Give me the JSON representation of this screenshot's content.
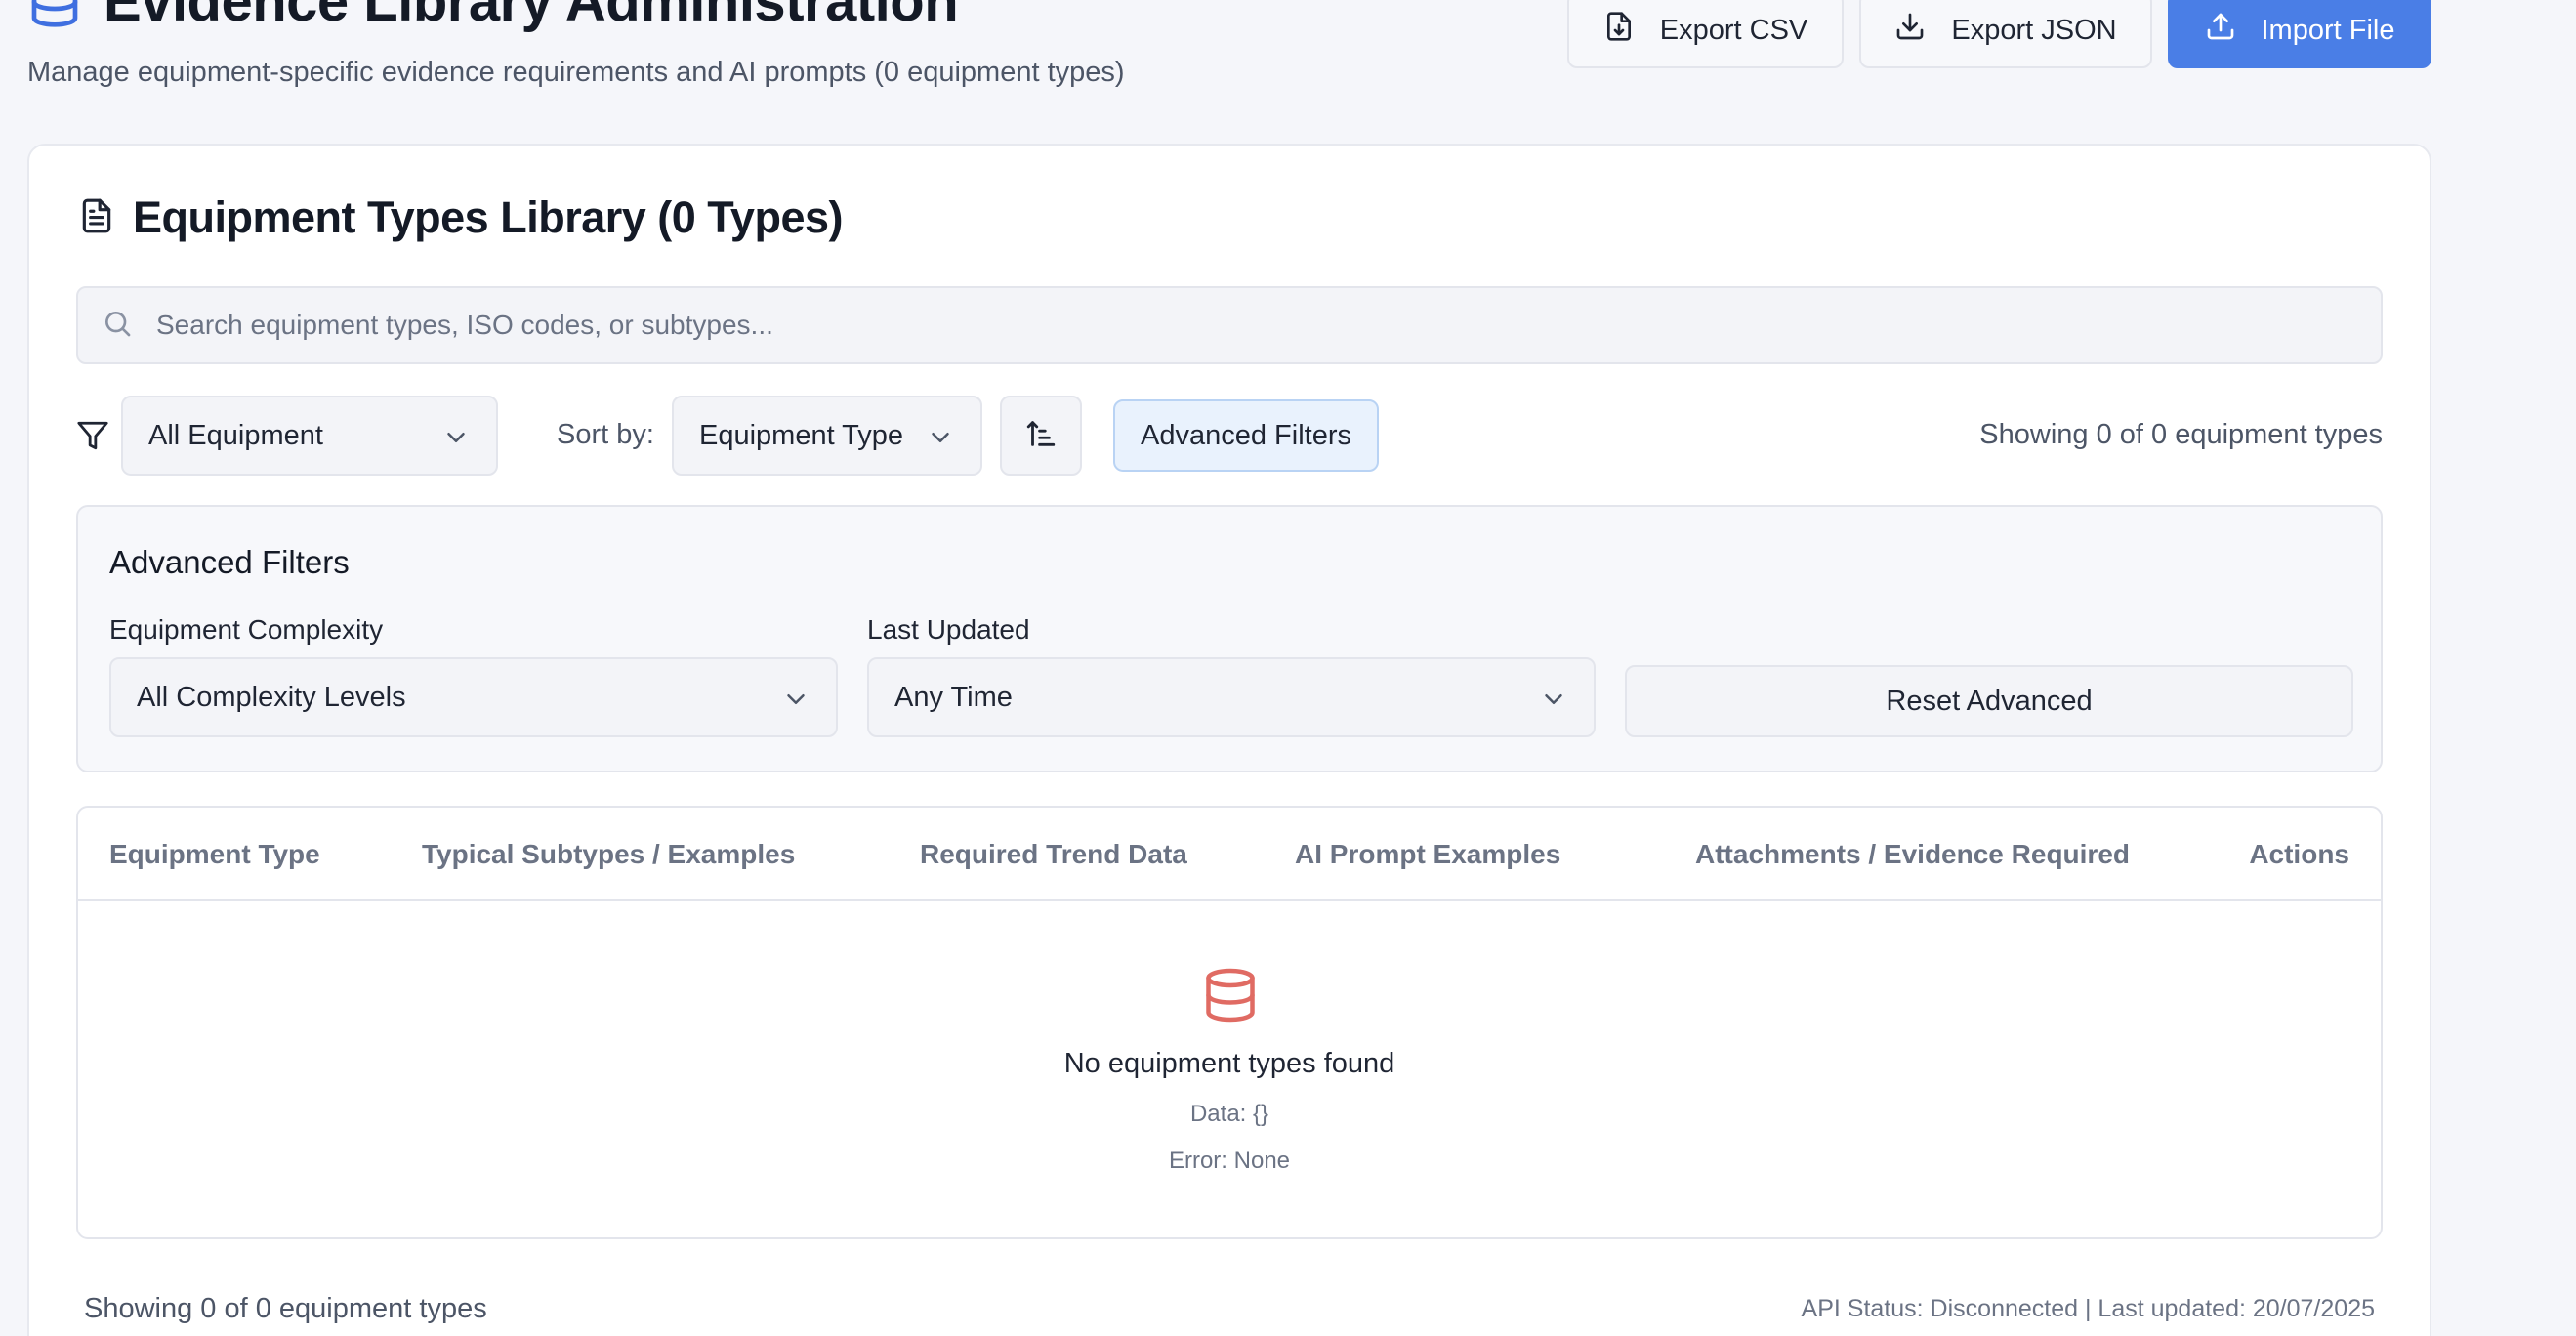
{
  "header": {
    "title": "Evidence Library Administration",
    "subtitle": "Manage equipment-specific evidence requirements and AI prompts (0 equipment types)",
    "title_icon": "database-icon",
    "actions": {
      "export_csv": "Export CSV",
      "export_json": "Export JSON",
      "import_file": "Import File"
    }
  },
  "library": {
    "title": "Equipment Types Library (0 Types)",
    "title_icon": "document-icon",
    "search": {
      "placeholder": "Search equipment types, ISO codes, or subtypes...",
      "value": ""
    },
    "filters": {
      "equipment_filter": "All Equipment",
      "sort_by_label": "Sort by:",
      "sort_by_value": "Equipment Type",
      "sort_direction_icon": "sort-ascending-icon",
      "advanced_toggle": "Advanced Filters",
      "showing": "Showing 0 of 0 equipment types"
    },
    "advanced": {
      "title": "Advanced Filters",
      "complexity_label": "Equipment Complexity",
      "complexity_value": "All Complexity Levels",
      "updated_label": "Last Updated",
      "updated_value": "Any Time",
      "reset_label": "Reset Advanced"
    },
    "table": {
      "columns": [
        "Equipment Type",
        "Typical Subtypes / Examples",
        "Required Trend Data",
        "AI Prompt Examples",
        "Attachments / Evidence Required",
        "Actions"
      ],
      "empty": {
        "icon": "database-icon",
        "title": "No equipment types found",
        "data_line": "Data: {}",
        "error_line": "Error: None"
      }
    },
    "footer": {
      "showing": "Showing 0 of 0 equipment types",
      "status": "API Status: Disconnected | Last updated: 20/07/2025"
    }
  },
  "colors": {
    "primary": "#4a7ee6",
    "empty_icon": "#e06b63",
    "advanced_toggle_bg": "#e9f2fd"
  }
}
